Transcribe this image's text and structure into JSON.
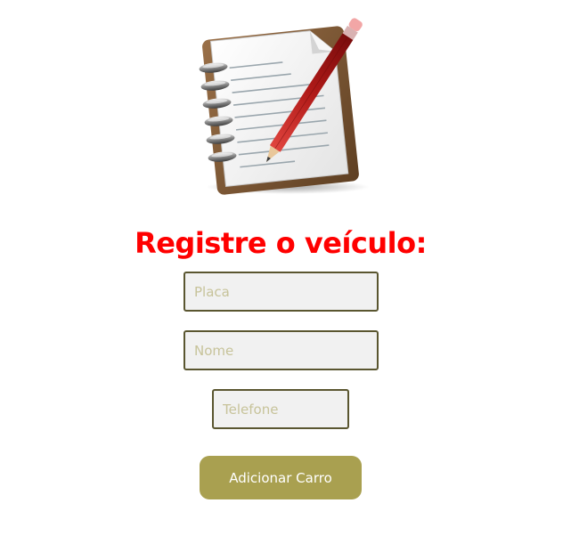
{
  "header": {
    "illustration_icon": "notebook-pencil-icon"
  },
  "form": {
    "title": "Registre o veículo:",
    "placa_placeholder": "Placa",
    "nome_placeholder": "Nome",
    "telefone_placeholder": "Telefone",
    "submit_label": "Adicionar Carro"
  },
  "colors": {
    "title": "#ff0000",
    "button_background": "#a9a050",
    "button_text": "#ffffff",
    "field_border": "#5a5630",
    "field_background": "#f1f1f1",
    "placeholder": "#c7c39a"
  }
}
